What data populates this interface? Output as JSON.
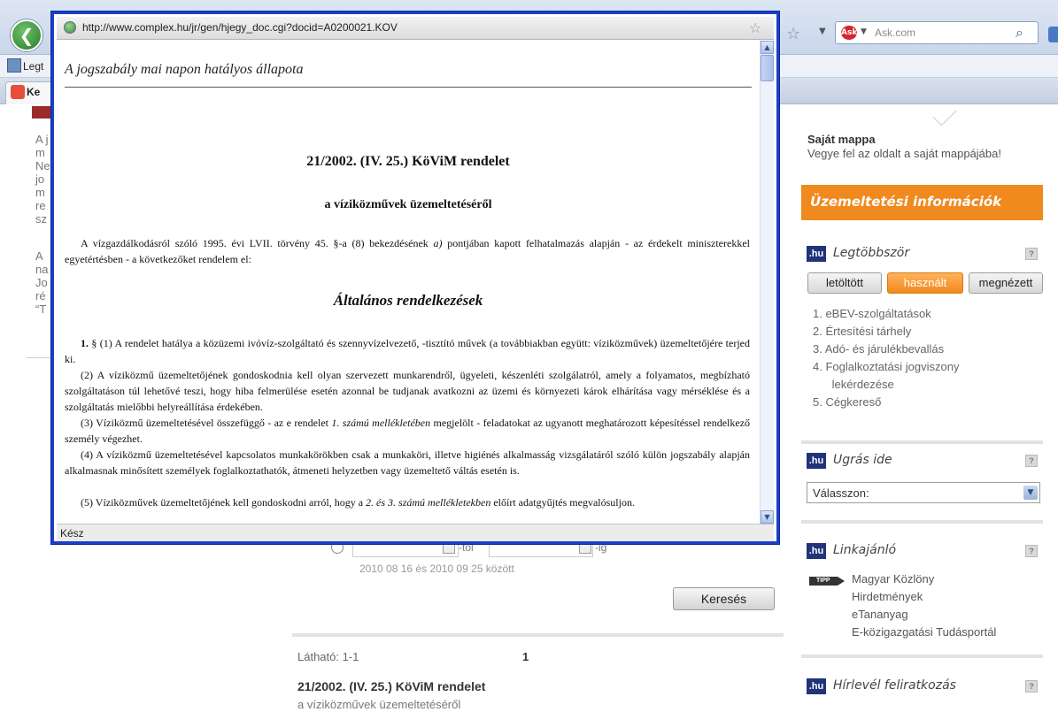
{
  "browser": {
    "search_placeholder": "Ask.com",
    "ask_logo": "Ask",
    "bookmark_label": "Legt",
    "tab_label": "Ke"
  },
  "left_fragments": [
    "A j",
    "m",
    "Ne",
    "jo",
    "m",
    "re",
    "sz",
    "A",
    "na",
    "Jo",
    "ré",
    "“T"
  ],
  "popup": {
    "url": "http://www.complex.hu/jr/gen/hjegy_doc.cgi?docid=A0200021.KOV",
    "status": "Kész",
    "doc": {
      "state": "A jogszabály mai napon hatályos állapota",
      "title": "21/2002. (IV. 25.) KöViM rendelet",
      "subtitle": "a víziközművek üzemeltetéséről",
      "preamble_a": "A vízgazdálkodásról szóló 1995. évi LVII. törvény 45. §-a (8) bekezdésének",
      "preamble_italic": "a)",
      "preamble_b": "pontjában kapott felhatalmazás alapján - az érdekelt miniszterekkel egyetértésben - a következőket rendelem el:",
      "section": "Általános rendelkezések",
      "p1_num": "1.",
      "p1": "§ (1) A rendelet hatálya a közüzemi ivóvíz-szolgáltató és szennyvízelvezető, -tisztító művek (a továbbiakban együtt: víziközművek) üzemeltetőjére terjed ki.",
      "p2": "(2) A víziközmű üzemeltetőjének gondoskodnia kell olyan szervezett munkarendről, ügyeleti, készenléti szolgálatról, amely a folyamatos, megbízható szolgáltatáson túl lehetővé teszi, hogy hiba felmerülése esetén azonnal be tudjanak avatkozni az üzemi és környezeti károk elhárítása vagy mérséklése és a szolgáltatás mielőbbi helyreállítása érdekében.",
      "p3_a": "(3) Víziközmű üzemeltetésével összefüggő - az e rendelet",
      "p3_italic": "1. számú mellékletében",
      "p3_b": "megjelölt - feladatokat az ugyanott meghatározott képesítéssel rendelkező személy végezhet.",
      "p4": "(4) A víziközmű üzemeltetésével kapcsolatos munkakörökben csak a munkaköri, illetve higiénés alkalmasság vizsgálatáról szóló külön jogszabály alapján alkalmasnak minősített személyek foglalkoztathatók, átmeneti helyzetben vagy üzemeltető váltás esetén is.",
      "p5_a": "(5) Víziközművek üzemeltetőjének kell gondoskodni arról, hogy a",
      "p5_italic": "2. és 3. számú mellékletekben",
      "p5_b": "előírt adatgyűjtés megvalósuljon."
    }
  },
  "sidebar": {
    "folder_title": "Saját mappa",
    "folder_sub": "Vegye fel az oldalt a saját mappájába!",
    "orange_title": "Üzemeltetési információk",
    "hu": ".hu",
    "help": "?",
    "most_title": "Legtöbbször",
    "tabs": [
      "letöltött",
      "használt",
      "megnézett"
    ],
    "ranked": [
      "1.  eBEV-szolgáltatások",
      "2.  Értesítési tárhely",
      "3.  Adó- és járulékbevallás",
      "4.  Foglalkoztatási jogviszony",
      "      lekérdezése",
      "5.  Cégkereső"
    ],
    "jump_title": "Ugrás ide",
    "select_value": "Válasszon:",
    "links_title": "Linkajánló",
    "tipp": "TIPP",
    "links": [
      "Magyar Közlöny",
      "Hirdetmények",
      "eTananyag",
      "E-közigazgatási Tudásportál"
    ],
    "newsletter_title": "Hírlevél feliratkozás"
  },
  "search_area": {
    "from_label": "-tól",
    "to_label": "-ig",
    "range_text": "2010 08 16 és 2010 09 25 között",
    "search_button": "Keresés",
    "visible_label": "Látható: 1-1",
    "page": "1",
    "result_title": "21/2002. (IV. 25.) KöViM rendelet",
    "result_sub": "a víziközművek üzemeltetéséről"
  }
}
